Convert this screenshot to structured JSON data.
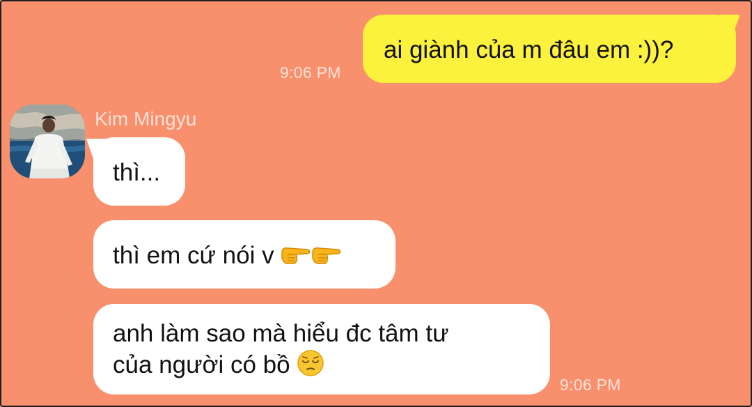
{
  "chat": {
    "outgoing": [
      {
        "text": "ai giành của m đâu em :))?",
        "time": "9:06 PM"
      }
    ],
    "incoming": {
      "sender": "Kim Mingyu",
      "avatar_icon": "profile-photo",
      "messages": [
        {
          "text": "thì..."
        },
        {
          "text": "thì em cứ nói v",
          "emoji": [
            "backhand-index-pointing-right",
            "backhand-index-pointing-right"
          ]
        },
        {
          "line1": "anh làm sao mà hiểu đc tâm tư",
          "line2": "của người có bồ",
          "emoji": [
            "pensive-face"
          ]
        }
      ],
      "time": "9:06 PM"
    }
  },
  "colors": {
    "background": "#f8906d",
    "outgoing_bubble": "#fcf13d",
    "incoming_bubble": "#ffffff",
    "timestamp": "#fde2d7"
  }
}
